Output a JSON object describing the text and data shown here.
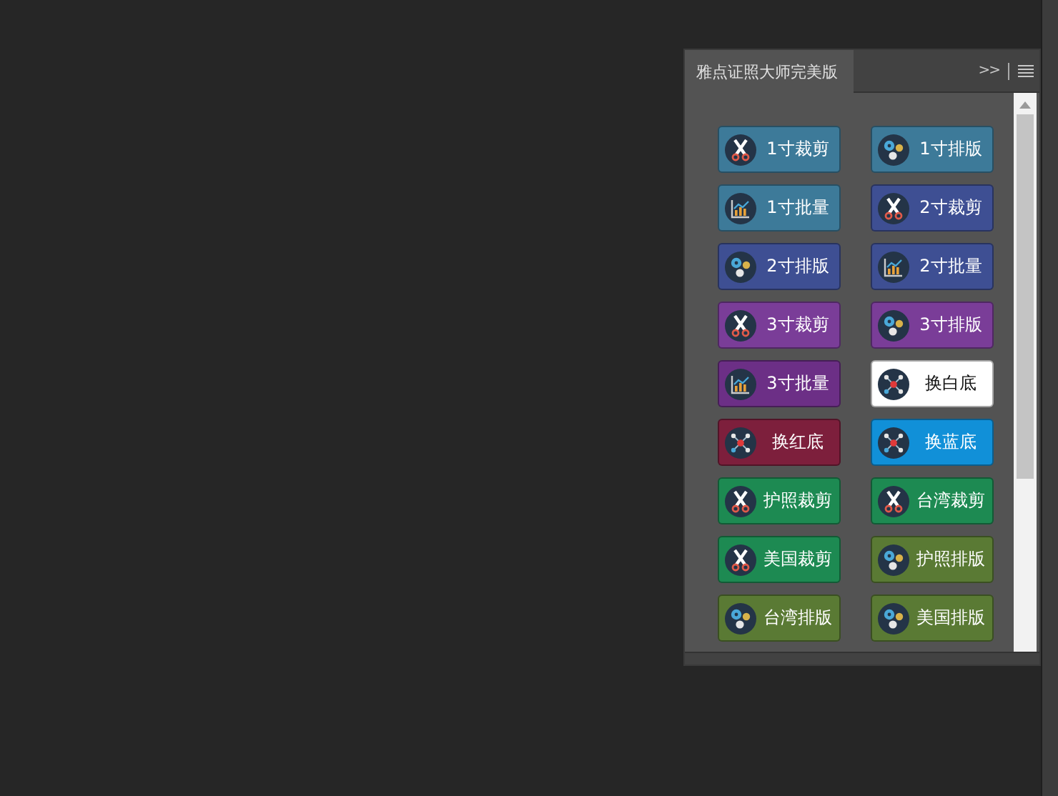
{
  "panel": {
    "title": "雅点证照大师完美版",
    "expand_glyph": ">>"
  },
  "buttons": [
    {
      "label": "1寸裁剪",
      "kind": "scissors",
      "color": "#3d7a99"
    },
    {
      "label": "1寸排版",
      "kind": "gears",
      "color": "#3d7a99"
    },
    {
      "label": "1寸批量",
      "kind": "chart",
      "color": "#3d7a99"
    },
    {
      "label": "2寸裁剪",
      "kind": "scissors",
      "color": "#3e4f93"
    },
    {
      "label": "2寸排版",
      "kind": "gears",
      "color": "#3e4f93"
    },
    {
      "label": "2寸批量",
      "kind": "chart",
      "color": "#3e4f93"
    },
    {
      "label": "3寸裁剪",
      "kind": "scissors",
      "color": "#7a3d98"
    },
    {
      "label": "3寸排版",
      "kind": "gears",
      "color": "#7a3d98"
    },
    {
      "label": "3寸批量",
      "kind": "chart",
      "color": "#6c2f86"
    },
    {
      "label": "换白底",
      "kind": "molecule",
      "color": "#ffffff"
    },
    {
      "label": "换红底",
      "kind": "molecule",
      "color": "#7d1f3c"
    },
    {
      "label": "换蓝底",
      "kind": "molecule",
      "color": "#1190d8"
    },
    {
      "label": "护照裁剪",
      "kind": "scissors",
      "color": "#1d8a52"
    },
    {
      "label": "台湾裁剪",
      "kind": "scissors",
      "color": "#1d8a52"
    },
    {
      "label": "美国裁剪",
      "kind": "scissors",
      "color": "#1d8a52"
    },
    {
      "label": "护照排版",
      "kind": "gears",
      "color": "#5a7a34"
    },
    {
      "label": "台湾排版",
      "kind": "gears",
      "color": "#5a7a34"
    },
    {
      "label": "美国排版",
      "kind": "gears",
      "color": "#5a7a34"
    }
  ]
}
